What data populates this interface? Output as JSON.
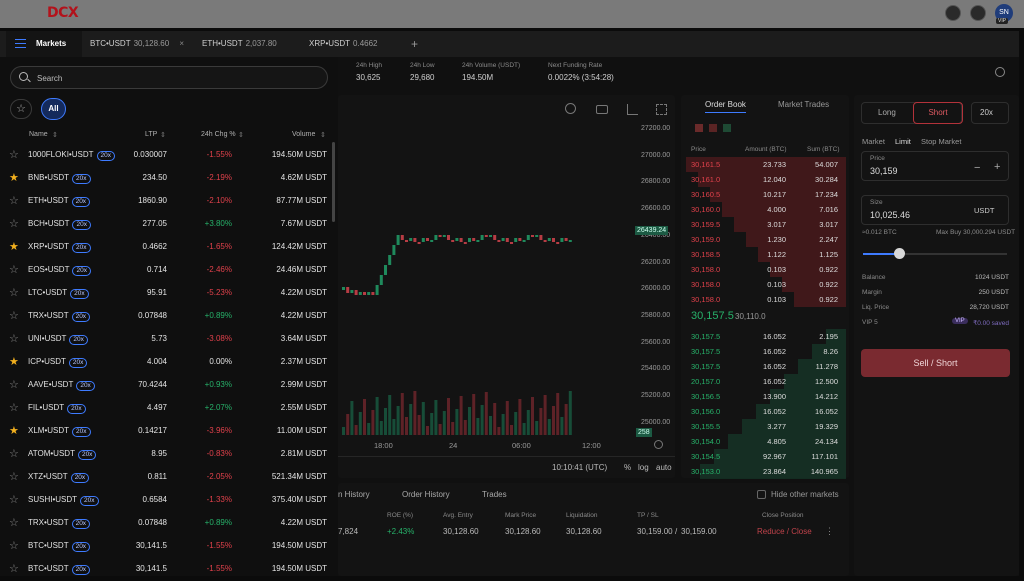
{
  "header": {
    "logo": "DCX",
    "avatar_initials": "SN",
    "vip": "VIP"
  },
  "tabs": [
    {
      "label": "Markets"
    },
    {
      "label": "BTC•USDT",
      "value": "30,128.60"
    },
    {
      "label": "ETH•USDT",
      "value": "2,037.80"
    },
    {
      "label": "XRP•USDT",
      "value": "0.4662"
    }
  ],
  "add_tab_icon": "+",
  "ticker": {
    "high_label": "24h High",
    "high": "30,625",
    "low_label": "24h Low",
    "low": "29,680",
    "volume_label": "24h Volume (USDT)",
    "volume": "194.50M",
    "funding_label": "Next Funding Rate",
    "funding": "0.0022% (3:54:28)"
  },
  "markets": {
    "search_placeholder": "Search",
    "filter_all": "All",
    "columns": {
      "name": "Name",
      "ltp": "LTP",
      "chg": "24h Chg %",
      "volume": "Volume"
    },
    "rows": [
      {
        "fav": false,
        "symbol": "1000FLOKI•USDT",
        "lev": "20x",
        "ltp": "0.030007",
        "chg": "-1.55%",
        "dir": "neg",
        "vol": "194.50M USDT"
      },
      {
        "fav": true,
        "symbol": "BNB•USDT",
        "lev": "20x",
        "ltp": "234.50",
        "chg": "-2.19%",
        "dir": "neg",
        "vol": "4.62M USDT"
      },
      {
        "fav": false,
        "symbol": "ETH•USDT",
        "lev": "20x",
        "ltp": "1860.90",
        "chg": "-2.10%",
        "dir": "neg",
        "vol": "87.77M USDT"
      },
      {
        "fav": false,
        "symbol": "BCH•USDT",
        "lev": "20x",
        "ltp": "277.05",
        "chg": "+3.80%",
        "dir": "pos",
        "vol": "7.67M USDT"
      },
      {
        "fav": true,
        "symbol": "XRP•USDT",
        "lev": "20x",
        "ltp": "0.4662",
        "chg": "-1.65%",
        "dir": "neg",
        "vol": "124.42M USDT"
      },
      {
        "fav": false,
        "symbol": "EOS•USDT",
        "lev": "20x",
        "ltp": "0.714",
        "chg": "-2.46%",
        "dir": "neg",
        "vol": "24.46M USDT"
      },
      {
        "fav": false,
        "symbol": "LTC•USDT",
        "lev": "20x",
        "ltp": "95.91",
        "chg": "-5.23%",
        "dir": "neg",
        "vol": "4.22M USDT"
      },
      {
        "fav": false,
        "symbol": "TRX•USDT",
        "lev": "20x",
        "ltp": "0.07848",
        "chg": "+0.89%",
        "dir": "pos",
        "vol": "4.22M USDT"
      },
      {
        "fav": false,
        "symbol": "UNI•USDT",
        "lev": "20x",
        "ltp": "5.73",
        "chg": "-3.08%",
        "dir": "neg",
        "vol": "3.64M USDT"
      },
      {
        "fav": true,
        "symbol": "ICP•USDT",
        "lev": "20x",
        "ltp": "4.004",
        "chg": "0.00%",
        "dir": "zero",
        "vol": "2.37M USDT"
      },
      {
        "fav": false,
        "symbol": "AAVE•USDT",
        "lev": "20x",
        "ltp": "70.4244",
        "chg": "+0.93%",
        "dir": "pos",
        "vol": "2.99M USDT"
      },
      {
        "fav": false,
        "symbol": "FIL•USDT",
        "lev": "20x",
        "ltp": "4.497",
        "chg": "+2.07%",
        "dir": "pos",
        "vol": "2.55M USDT"
      },
      {
        "fav": true,
        "symbol": "XLM•USDT",
        "lev": "20x",
        "ltp": "0.14217",
        "chg": "-3.96%",
        "dir": "neg",
        "vol": "11.00M USDT"
      },
      {
        "fav": false,
        "symbol": "ATOM•USDT",
        "lev": "20x",
        "ltp": "8.95",
        "chg": "-0.83%",
        "dir": "neg",
        "vol": "2.81M USDT"
      },
      {
        "fav": false,
        "symbol": "XTZ•USDT",
        "lev": "20x",
        "ltp": "0.811",
        "chg": "-2.05%",
        "dir": "neg",
        "vol": "521.34M USDT"
      },
      {
        "fav": false,
        "symbol": "SUSHI•USDT",
        "lev": "20x",
        "ltp": "0.6584",
        "chg": "-1.33%",
        "dir": "neg",
        "vol": "375.40M USDT"
      },
      {
        "fav": false,
        "symbol": "TRX•USDT",
        "lev": "20x",
        "ltp": "0.07848",
        "chg": "+0.89%",
        "dir": "pos",
        "vol": "4.22M USDT"
      },
      {
        "fav": false,
        "symbol": "BTC•USDT",
        "lev": "20x",
        "ltp": "30,141.5",
        "chg": "-1.55%",
        "dir": "neg",
        "vol": "194.50M USDT"
      },
      {
        "fav": false,
        "symbol": "BTC•USDT",
        "lev": "20x",
        "ltp": "30,141.5",
        "chg": "-1.55%",
        "dir": "neg",
        "vol": "194.50M USDT"
      }
    ]
  },
  "chart": {
    "price_axis": [
      "27200.00",
      "27000.00",
      "26800.00",
      "26600.00",
      "26400.00",
      "26200.00",
      "26000.00",
      "25800.00",
      "25600.00",
      "25400.00",
      "25200.00",
      "25000.00"
    ],
    "current_price": "26439.24",
    "volume_tag": "258",
    "time_axis": [
      "18:00",
      "24",
      "06:00",
      "12:00"
    ],
    "clock": "10:10:41 (UTC)",
    "scale_pct": "%",
    "scale_log": "log",
    "scale_auto": "auto"
  },
  "orderbook": {
    "tab_book": "Order Book",
    "tab_trades": "Market Trades",
    "col_price": "Price",
    "col_amount": "Amount (BTC)",
    "col_sum": "Sum (BTC)",
    "asks": [
      [
        "30,161.5",
        "23.733",
        "54.007"
      ],
      [
        "30,161.0",
        "12.040",
        "30.284"
      ],
      [
        "30,160.5",
        "10.217",
        "17.234"
      ],
      [
        "30,160.0",
        "4.000",
        "7.016"
      ],
      [
        "30,159.5",
        "3.017",
        "3.017"
      ],
      [
        "30,159.0",
        "1.230",
        "2.247"
      ],
      [
        "30,158.5",
        "1.122",
        "1.125"
      ],
      [
        "30,158.0",
        "0.103",
        "0.922"
      ],
      [
        "30,158.0",
        "0.103",
        "0.922"
      ],
      [
        "30,158.0",
        "0.103",
        "0.922"
      ]
    ],
    "mid_price": "30,157.5",
    "mid_sub": "30,110.0",
    "bids": [
      [
        "30,157.5",
        "16.052",
        "2.195"
      ],
      [
        "30,157.5",
        "16.052",
        "8.26"
      ],
      [
        "30,157.5",
        "16.052",
        "11.278"
      ],
      [
        "20,157.0",
        "16.052",
        "12.500"
      ],
      [
        "30,156.5",
        "13.900",
        "14.212"
      ],
      [
        "30,156.0",
        "16.052",
        "16.052"
      ],
      [
        "30,155.5",
        "3.277",
        "19.329"
      ],
      [
        "30,154.0",
        "4.805",
        "24.134"
      ],
      [
        "30,154.5",
        "92.967",
        "117.101"
      ],
      [
        "30,153.0",
        "23.864",
        "140.965"
      ]
    ]
  },
  "order_form": {
    "long": "Long",
    "short": "Short",
    "leverage": "20x",
    "type_market": "Market",
    "type_limit": "Limit",
    "type_stop": "Stop Market",
    "price_label": "Price",
    "price": "30,159",
    "size_label": "Size",
    "size": "10,025.46",
    "size_unit": "USDT",
    "btc_equiv": "≈0.012 BTC",
    "max_buy": "Max Buy 30,000.294 USDT",
    "slider_pct": 0.25,
    "balance_label": "Balance",
    "balance": "1024 USDT",
    "margin_label": "Margin",
    "margin": "250 USDT",
    "liq_label": "Liq. Price",
    "liq": "28,720 USDT",
    "vip_label": "VIP 5",
    "vip_badge": "VIP",
    "vip_saved": "₹0.00 saved",
    "submit": "Sell / Short"
  },
  "positions": {
    "tabs": [
      "n History",
      "Order History",
      "Trades"
    ],
    "hide_other": "Hide other markets",
    "columns": [
      "ROE (%)",
      "Avg. Entry",
      "Mark Price",
      "Liquidation",
      "TP / SL",
      "Close Position"
    ],
    "row": {
      "size": "7,824",
      "roe": "+2.43%",
      "entry": "30,128.60",
      "mark": "30,128.60",
      "liq": "30,128.60",
      "tp": "30,159.00",
      "sl": "30,159.00",
      "close": "Reduce / Close"
    }
  }
}
